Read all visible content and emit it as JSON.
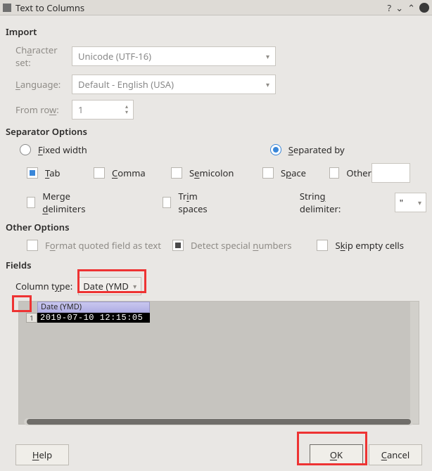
{
  "window": {
    "title": "Text to Columns"
  },
  "import": {
    "title": "Import",
    "charset_label_pre": "Ch",
    "charset_label_u": "a",
    "charset_label_post": "racter set:",
    "charset_value": "Unicode (UTF-16)",
    "language_label_pre": "",
    "language_label_u": "L",
    "language_label_post": "anguage:",
    "language_value": "Default - English (USA)",
    "fromrow_label_pre": "From ro",
    "fromrow_label_u": "w",
    "fromrow_label_post": ":",
    "fromrow_value": "1"
  },
  "separator": {
    "title": "Separator Options",
    "fixed_pre": "",
    "fixed_u": "F",
    "fixed_post": "ixed width",
    "separated_pre": "",
    "separated_u": "S",
    "separated_post": "eparated by",
    "tab_pre": "",
    "tab_u": "T",
    "tab_post": "ab",
    "comma_pre": "",
    "comma_u": "C",
    "comma_post": "omma",
    "semi_pre": "S",
    "semi_u": "e",
    "semi_post": "micolon",
    "space_pre": "S",
    "space_u": "p",
    "space_post": "ace",
    "other_label": "Other",
    "merge_pre": "Merge ",
    "merge_u": "d",
    "merge_post": "elimiters",
    "trim_pre": "Tr",
    "trim_u": "i",
    "trim_post": "m spaces",
    "strdelim_label_pre": "Strin",
    "strdelim_label_u": "g",
    "strdelim_label_post": " delimiter:",
    "strdelim_value": "\""
  },
  "other": {
    "title": "Other Options",
    "format_pre": "F",
    "format_u": "o",
    "format_post": "rmat quoted field as text",
    "detect_pre": "Detect special ",
    "detect_u": "n",
    "detect_post": "umbers",
    "skip_pre": "S",
    "skip_u": "k",
    "skip_post": "ip empty cells"
  },
  "fields": {
    "title": "Fields",
    "coltype_label_pre": "Column t",
    "coltype_label_u": "y",
    "coltype_label_post": "pe:",
    "coltype_value": "Date (YMD",
    "col_header": "Date (YMD)",
    "row1_num": "1",
    "row1_val": "2019-07-10 12:15:05"
  },
  "buttons": {
    "help_u": "H",
    "help_post": "elp",
    "ok_u": "O",
    "ok_post": "K",
    "cancel_u": "C",
    "cancel_post": "ancel"
  }
}
